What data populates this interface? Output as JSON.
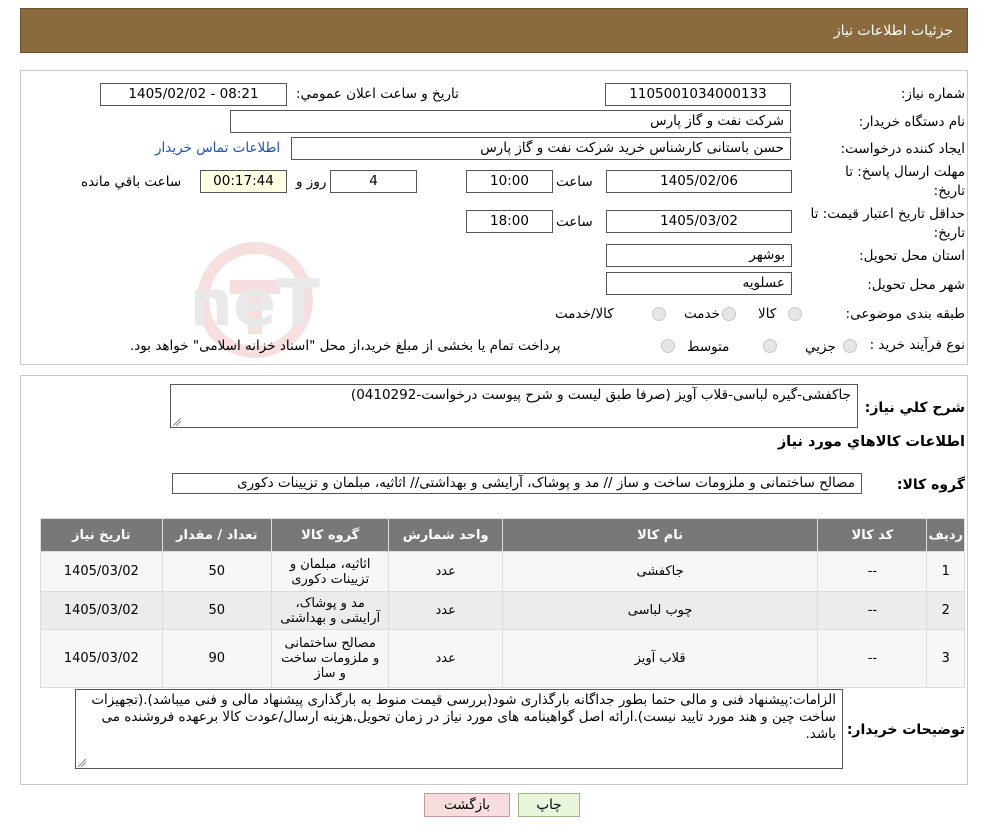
{
  "header": {
    "title": "جزئیات اطلاعات نیاز"
  },
  "form": {
    "need_number_label": "شماره نیاز:",
    "need_number": "1105001034000133",
    "announce_label": "تاریخ و ساعت اعلان عمومي:",
    "announce_value": "1405/02/02 - 08:21",
    "buyer_org_label": "نام دستگاه خریدار:",
    "buyer_org": "شرکت نفت و گاز پارس",
    "requester_label": "ایجاد کننده درخواست:",
    "requester": "حسن باستانی کارشناس خرید شرکت نفت و گاز پارس",
    "contact_link": "اطلاعات تماس خریدار",
    "deadline_label_1": "مهلت ارسال پاسخ: تا",
    "deadline_label_2": "تاریخ:",
    "deadline_date": "1405/02/06",
    "time_label": "ساعت",
    "deadline_time": "10:00",
    "days_value": "4",
    "days_label": "روز و",
    "remaining_time": "00:17:44",
    "remaining_label": "ساعت باقي مانده",
    "validity_label_1": "حداقل تاریخ اعتبار قیمت: تا",
    "validity_label_2": "تاریخ:",
    "validity_date": "1405/03/02",
    "validity_time_label": "ساعت",
    "validity_time": "18:00",
    "province_label": "استان محل تحویل:",
    "province": "بوشهر",
    "city_label": "شهر محل تحویل:",
    "city": "عسلویه",
    "category_label": "طبقه بندی موضوعی:",
    "category_options": [
      "کالا",
      "خدمت",
      "کالا/خدمت"
    ],
    "process_label": "نوع فرآیند خرید :",
    "process_options": [
      "جزیي",
      "متوسط"
    ],
    "process_note": "پرداخت تمام یا بخشی از مبلغ خرید،از محل \"اسناد خزانه اسلامی\" خواهد بود."
  },
  "description": {
    "label": "شرح کلي نیاز:",
    "text": "جاکفشی-گیره لباسی-قلاب آویز (صرفا طبق لیست و شرح پیوست درخواست-0410292)"
  },
  "goods_info_title": "اطلاعات کالاهاي مورد نیاز",
  "goods_group": {
    "label": "گروه کالا:",
    "value": "مصالح ساختمانی و ملزومات ساخت و ساز // مد و پوشاک، آرایشی و بهداشتی// اثاثیه، مبلمان و تزیینات دکوری"
  },
  "table": {
    "headers": [
      "ردیف",
      "کد کالا",
      "نام کالا",
      "واحد شمارش",
      "گروه کالا",
      "تعداد / مقدار",
      "تاریخ نیاز"
    ],
    "rows": [
      {
        "row": "1",
        "code": "--",
        "name": "جاکفشی",
        "unit": "عدد",
        "group": "اثاثیه، مبلمان و تزیینات دکوری",
        "qty": "50",
        "date": "1405/03/02"
      },
      {
        "row": "2",
        "code": "--",
        "name": "چوب لباسی",
        "unit": "عدد",
        "group": "مد و پوشاک، آرایشی و بهداشتی",
        "qty": "50",
        "date": "1405/03/02"
      },
      {
        "row": "3",
        "code": "--",
        "name": "قلاب آویز",
        "unit": "عدد",
        "group": "مصالح ساختمانی و ملزومات ساخت و ساز",
        "qty": "90",
        "date": "1405/03/02"
      }
    ]
  },
  "buyer_notes": {
    "label": "توضیحات خریدار:",
    "text": "الزامات:پیشنهاد فنی و مالی حتما  بطور جداگانه بارگذاری شود(بررسی قیمت منوط به بارگذاری پیشنهاد مالی و فنی میباشد).(تجهیزات ساخت چین و هند مورد تایید نیست).ارائه اصل گواهینامه های مورد نیاز در زمان تحویل.هزینه ارسال/عودت کالا برعهده فروشنده می باشد."
  },
  "buttons": {
    "print": "چاپ",
    "back": "بازگشت"
  },
  "watermark": {
    "text": "AriaTender.neT"
  }
}
